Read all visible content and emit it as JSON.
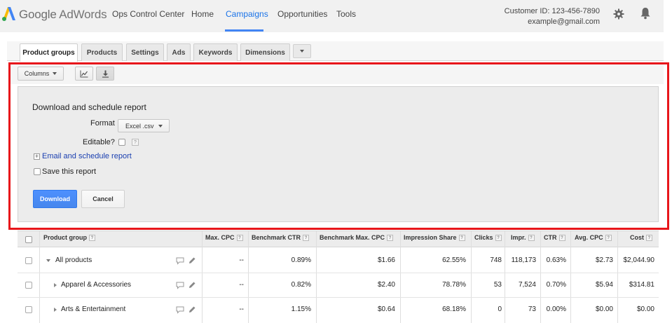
{
  "header": {
    "brand_google": "Google",
    "brand_product": "AdWords",
    "nav": [
      "Ops Control Center",
      "Home",
      "Campaigns",
      "Opportunities",
      "Tools"
    ],
    "active_nav": "Campaigns",
    "customer_id": "Customer ID: 123-456-7890",
    "email": "example@gmail.com",
    "accent": "#4285f4"
  },
  "tabs": [
    "Product groups",
    "Products",
    "Settings",
    "Ads",
    "Keywords",
    "Dimensions"
  ],
  "active_tab": "Product groups",
  "toolbar": {
    "columns_label": "Columns"
  },
  "report": {
    "title": "Download and schedule report",
    "format_label": "Format",
    "format_value": "Excel .csv",
    "editable_label": "Editable?",
    "email_link": "Email and schedule report",
    "save_label": "Save this report",
    "download_label": "Download",
    "cancel_label": "Cancel"
  },
  "table": {
    "columns": [
      "Product group",
      "Max. CPC",
      "Benchmark CTR",
      "Benchmark Max. CPC",
      "Impression Share",
      "Clicks",
      "Impr.",
      "CTR",
      "Avg. CPC",
      "Cost"
    ],
    "rows": [
      {
        "name": "All products",
        "max_cpc": "--",
        "bench_ctr": "0.89%",
        "bench_max_cpc": "$1.66",
        "imp_share": "62.55%",
        "clicks": "748",
        "impr": "118,173",
        "ctr": "0.63%",
        "avg_cpc": "$2.73",
        "cost": "$2,044.90"
      },
      {
        "name": "Apparel & Accessories",
        "max_cpc": "--",
        "bench_ctr": "0.82%",
        "bench_max_cpc": "$2.40",
        "imp_share": "78.78%",
        "clicks": "53",
        "impr": "7,524",
        "ctr": "0.70%",
        "avg_cpc": "$5.94",
        "cost": "$314.81"
      },
      {
        "name": "Arts & Entertainment",
        "max_cpc": "--",
        "bench_ctr": "1.15%",
        "bench_max_cpc": "$0.64",
        "imp_share": "68.18%",
        "clicks": "0",
        "impr": "73",
        "ctr": "0.00%",
        "avg_cpc": "$0.00",
        "cost": "$0.00"
      }
    ]
  }
}
